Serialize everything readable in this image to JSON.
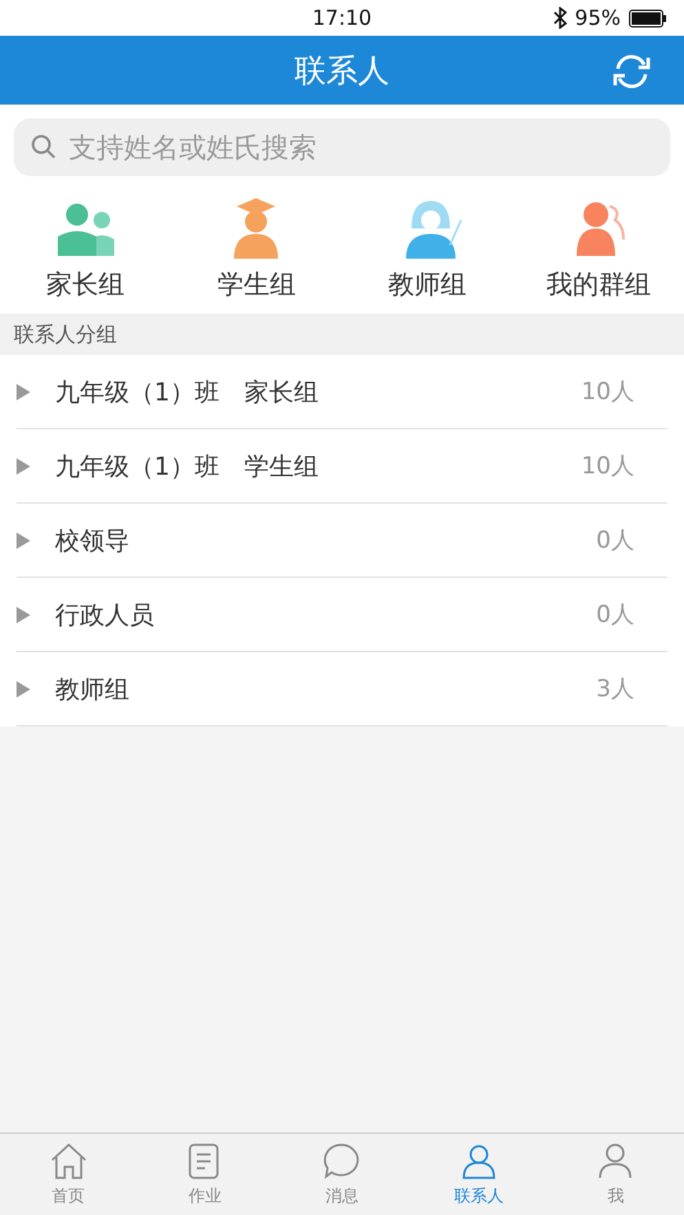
{
  "status_bar": {
    "time": "17:10",
    "battery": "95%"
  },
  "header": {
    "title": "联系人"
  },
  "search": {
    "placeholder": "支持姓名或姓氏搜索"
  },
  "shortcuts": [
    {
      "kind": "parent",
      "label": "家长组"
    },
    {
      "kind": "student",
      "label": "学生组"
    },
    {
      "kind": "teacher",
      "label": "教师组"
    },
    {
      "kind": "mygroup",
      "label": "我的群组"
    }
  ],
  "section_title": "联系人分组",
  "groups": [
    {
      "name": "九年级（1）班　家长组",
      "count": "10人",
      "expanded": false
    },
    {
      "name": "九年级（1）班　学生组",
      "count": "10人",
      "expanded": false
    },
    {
      "name": "校领导",
      "count": "0人",
      "expanded": false
    },
    {
      "name": "行政人员",
      "count": "0人",
      "expanded": false
    },
    {
      "name": "教师组",
      "count": "3人",
      "expanded": false
    }
  ],
  "tab_bar": [
    {
      "kind": "home",
      "label": "首页",
      "selected": false
    },
    {
      "kind": "homework",
      "label": "作业",
      "selected": false
    },
    {
      "kind": "message",
      "label": "消息",
      "selected": false
    },
    {
      "kind": "contacts",
      "label": "联系人",
      "selected": true
    },
    {
      "kind": "me",
      "label": "我",
      "selected": false
    }
  ]
}
